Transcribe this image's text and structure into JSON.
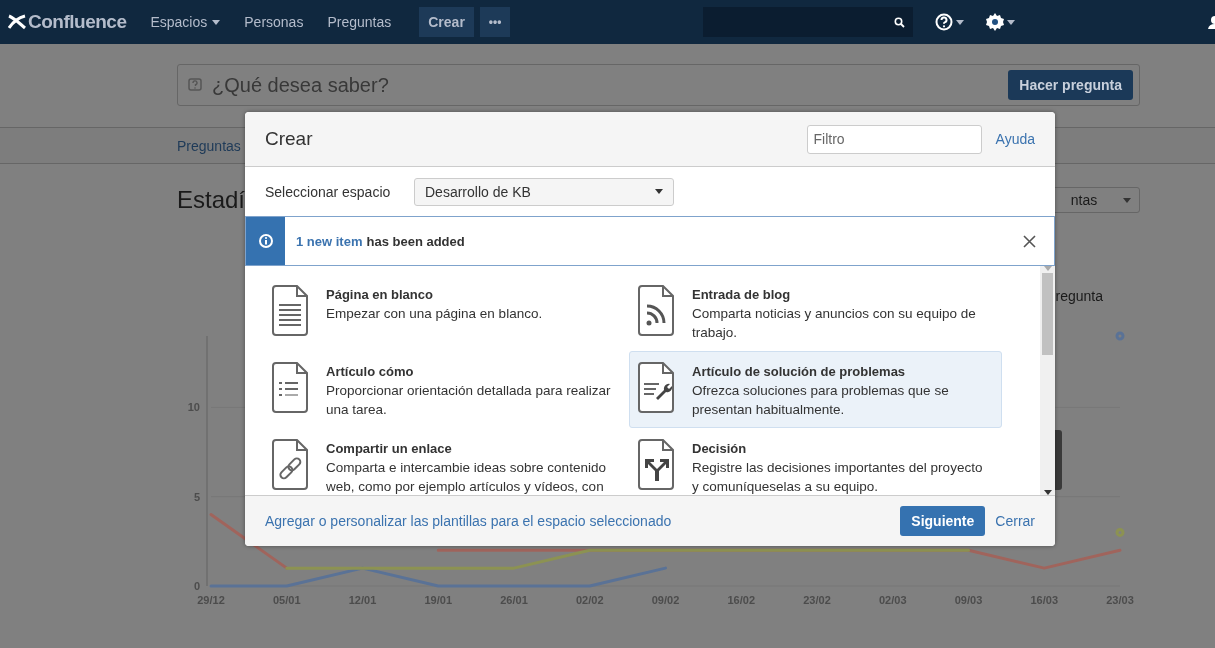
{
  "navbar": {
    "logo": "Confluence",
    "items": [
      {
        "label": "Espacios",
        "dropdown": true
      },
      {
        "label": "Personas",
        "dropdown": false
      },
      {
        "label": "Preguntas",
        "dropdown": false
      }
    ],
    "create_button": "Crear",
    "more_button": "•••"
  },
  "ask": {
    "placeholder": "¿Qué desea saber?",
    "button": "Hacer pregunta"
  },
  "subnav": {
    "tab": "Preguntas"
  },
  "stats": {
    "heading": "Estadí",
    "select_value": "ntas",
    "legend_text": "regunta",
    "chart_data": {
      "type": "line",
      "categories": [
        "29/12",
        "05/01",
        "12/01",
        "19/01",
        "26/01",
        "02/02",
        "09/02",
        "16/02",
        "23/02",
        "02/03",
        "09/03",
        "16/03",
        "23/03"
      ],
      "yticks": [
        0,
        5,
        10
      ],
      "ylim": [
        0,
        14
      ],
      "series": [
        {
          "color": "#a0645c",
          "values": [
            4,
            1,
            null,
            2,
            2,
            2,
            2,
            2,
            2,
            2,
            2,
            1,
            2
          ]
        },
        {
          "color": "#5a7296",
          "values": [
            0,
            0,
            1,
            0,
            0,
            0,
            1,
            null,
            null,
            null,
            null,
            null,
            14
          ]
        },
        {
          "color": "#8c9252",
          "values": [
            null,
            1,
            1,
            1,
            1,
            2,
            2,
            2,
            2,
            2,
            2,
            null,
            3
          ]
        }
      ]
    }
  },
  "dialog": {
    "title": "Crear",
    "filter_placeholder": "Filtro",
    "help_link": "Ayuda",
    "space_label": "Seleccionar espacio",
    "space_value": "Desarrollo de KB",
    "notice": {
      "link": "1 new item",
      "text": "has been added"
    },
    "templates": [
      {
        "kind": "blank",
        "title": "Página en blanco",
        "description": "Empezar con una página en blanco.",
        "selected": false
      },
      {
        "kind": "blog",
        "title": "Entrada de blog",
        "description": "Comparta noticias y anuncios con su equipo de trabajo.",
        "selected": false
      },
      {
        "kind": "howto",
        "title": "Artículo cómo",
        "description": "Proporcionar orientación detallada para realizar una tarea.",
        "selected": false
      },
      {
        "kind": "troubleshooting",
        "title": "Artículo de solución de problemas",
        "description": "Ofrezca soluciones para problemas que se presentan habitualmente.",
        "selected": true
      },
      {
        "kind": "link",
        "title": "Compartir un enlace",
        "description": "Comparta e intercambie ideas sobre contenido web, como por ejemplo artículos y vídeos, con",
        "selected": false
      },
      {
        "kind": "decision",
        "title": "Decisión",
        "description": "Registre las decisiones importantes del proyecto y comuníqueselas a su equipo.",
        "selected": false
      }
    ],
    "footer_link": "Agregar o personalizar las plantillas para el espacio seleccionado",
    "next_button": "Siguiente",
    "close_link": "Cerrar"
  }
}
